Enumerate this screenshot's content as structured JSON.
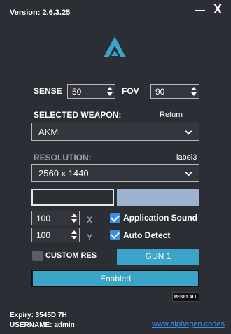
{
  "header": {
    "version": "Version: 2.6.3.25",
    "close_label": "X"
  },
  "settings": {
    "sense_label": "SENSE",
    "sense_value": "50",
    "fov_label": "FOV",
    "fov_value": "90"
  },
  "weapon": {
    "label": "SELECTED WEAPON:",
    "return_label": "Return",
    "selected": "AKM"
  },
  "resolution": {
    "label": "RESOLUTION:",
    "aux_label": "label3",
    "selected": "2560 x 1440"
  },
  "offsets": {
    "x_value": "100",
    "x_label": "X",
    "y_value": "100",
    "y_label": "Y"
  },
  "options": {
    "application_sound": "Application Sound",
    "auto_detect": "Auto Detect",
    "custom_res": "CUSTOM RES"
  },
  "buttons": {
    "gun": "GUN 1",
    "enabled": "Enabled",
    "reset_all": "RESET ALL"
  },
  "footer": {
    "expiry": "Expiry: 3545D 7H",
    "username": "USERNAME: admin",
    "link": "www.alphagen.codes"
  },
  "colors": {
    "background": "#2b2e34",
    "accent_teal": "#3aa5c9",
    "swatch_light": "#9db3d0",
    "checkbox_blue": "#3a8ee6",
    "link": "#3d8fe8"
  }
}
